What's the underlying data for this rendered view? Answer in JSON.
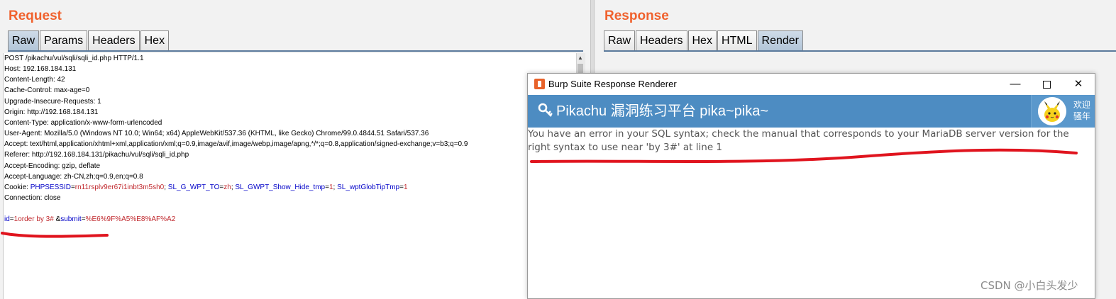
{
  "request": {
    "title": "Request",
    "tabs": [
      {
        "label": "Raw",
        "active": true
      },
      {
        "label": "Params",
        "active": false
      },
      {
        "label": "Headers",
        "active": false
      },
      {
        "label": "Hex",
        "active": false
      }
    ],
    "lines": [
      "POST /pikachu/vul/sqli/sqli_id.php HTTP/1.1",
      "Host: 192.168.184.131",
      "Content-Length: 42",
      "Cache-Control: max-age=0",
      "Upgrade-Insecure-Requests: 1",
      "Origin: http://192.168.184.131",
      "Content-Type: application/x-www-form-urlencoded",
      "User-Agent: Mozilla/5.0 (Windows NT 10.0; Win64; x64) AppleWebKit/537.36 (KHTML, like Gecko) Chrome/99.0.4844.51 Safari/537.36",
      "Accept: text/html,application/xhtml+xml,application/xml;q=0.9,image/avif,image/webp,image/apng,*/*;q=0.8,application/signed-exchange;v=b3;q=0.9",
      "Referer: http://192.168.184.131/pikachu/vul/sqli/sqli_id.php",
      "Accept-Encoding: gzip, deflate",
      "Accept-Language: zh-CN,zh;q=0.9,en;q=0.8"
    ],
    "cookie": {
      "label": "Cookie: ",
      "parts": [
        {
          "key": "PHPSESSID",
          "value": "rn11rsplv9er67i1inbt3m5sh0"
        },
        {
          "key": "SL_G_WPT_TO",
          "value": "zh"
        },
        {
          "key": "SL_GWPT_Show_Hide_tmp",
          "value": "1"
        },
        {
          "key": "SL_wptGlobTipTmp",
          "value": "1"
        }
      ]
    },
    "connection": "Connection: close",
    "body": {
      "id_key": "id",
      "id_value": "1order by 3#",
      "submit_key": "submit",
      "submit_value": "%E6%9F%A5%E8%AF%A2"
    }
  },
  "response": {
    "title": "Response",
    "tabs": [
      {
        "label": "Raw",
        "active": false
      },
      {
        "label": "Headers",
        "active": false
      },
      {
        "label": "Hex",
        "active": false
      },
      {
        "label": "HTML",
        "active": false
      },
      {
        "label": "Render",
        "active": true
      }
    ]
  },
  "renderer": {
    "window_title": "Burp Suite Response Renderer",
    "minimize_glyph": "—",
    "close_glyph": "✕",
    "header_icon": "🔍",
    "header_title": "Pikachu 漏洞练习平台 pika~pika~",
    "welcome_line1": "欢迎",
    "welcome_line2": "骚年",
    "error_message": "You have an error in your SQL syntax; check the manual that corresponds to your MariaDB server version for the right syntax to use near 'by 3#' at line 1"
  },
  "watermark": "CSDN @小白头发少",
  "colors": {
    "title_orange": "#f0622e",
    "active_tab": "#b2c5d8",
    "header_blue": "#4d8cc2",
    "annotation_red": "#e0141e",
    "key_blue": "#0000c8",
    "value_red": "#c0282d"
  },
  "icons": [
    "burp-icon",
    "key-icon",
    "pikachu-avatar",
    "minimize-icon",
    "maximize-icon",
    "close-icon"
  ]
}
